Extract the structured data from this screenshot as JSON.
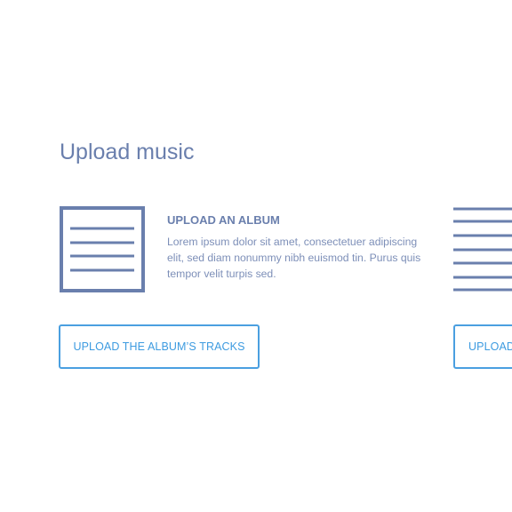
{
  "section": {
    "title": "Upload music"
  },
  "options": [
    {
      "icon": "document-lines-icon",
      "heading": "UPLOAD AN ALBUM",
      "description": "Lorem ipsum dolor sit amet, consectetuer adipiscing elit, sed diam nonummy nibh euismod tin. Purus quis tempor velit turpis sed.",
      "button_label": "UPLOAD THE ALBUM’S TRACKS"
    },
    {
      "icon": "list-lines-icon",
      "button_label": "UPLOAD"
    }
  ],
  "colors": {
    "heading": "#6a7fad",
    "body_text": "#7d8fb8",
    "accent": "#4a9fe0",
    "icon": "#6a7fad"
  }
}
